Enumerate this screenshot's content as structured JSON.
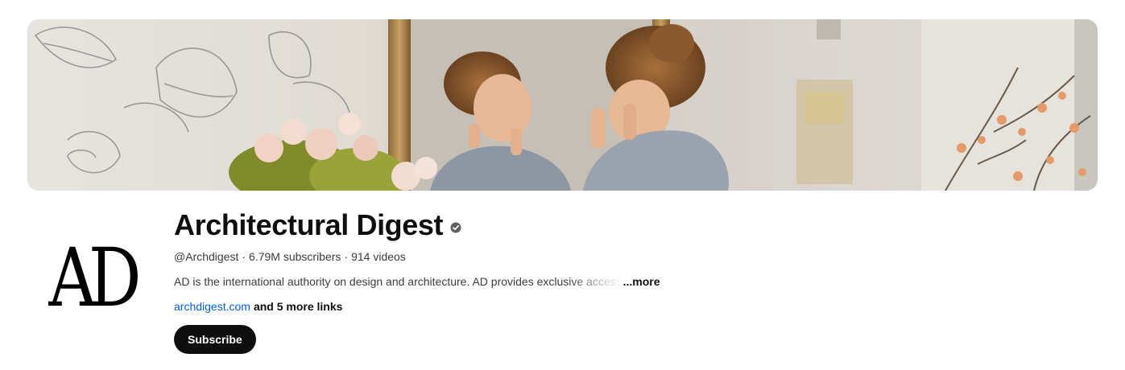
{
  "banner": {
    "icon": "channel-banner-image"
  },
  "avatar": {
    "logo_text": "AD"
  },
  "channel": {
    "title": "Architectural Digest",
    "verified_icon": "verified-check-icon",
    "handle": "@Archdigest",
    "subscribers": "6.79M subscribers",
    "videos": "914 videos",
    "separator": "·",
    "description": "AD is the international authority on design and architecture. AD provides exclusive access",
    "more_label": "...more",
    "primary_link": "archdigest.com",
    "more_links_label": "and 5 more links",
    "subscribe_label": "Subscribe"
  },
  "colors": {
    "link": "#065fd4",
    "subscribe_bg": "#0f0f0f",
    "subscribe_text": "#ffffff"
  }
}
